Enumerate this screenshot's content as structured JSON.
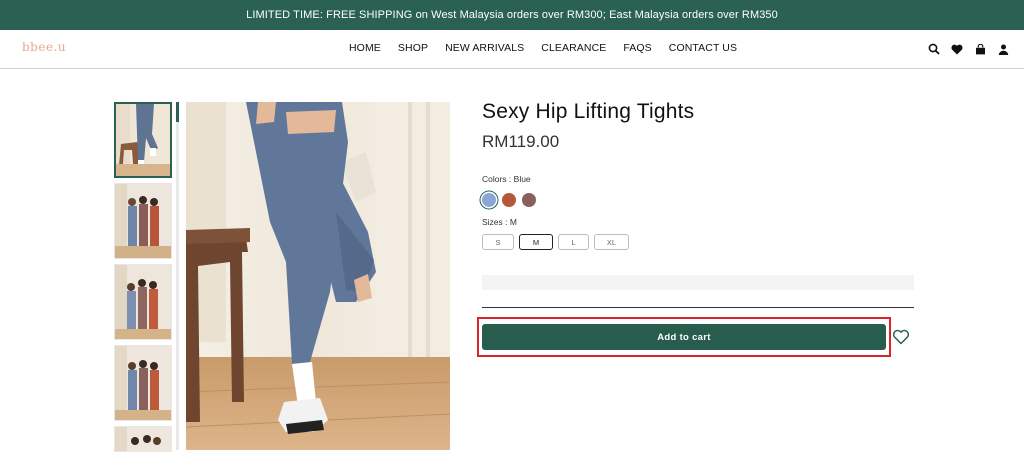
{
  "announcement": "LIMITED TIME: FREE SHIPPING on West Malaysia orders over RM300; East Malaysia orders over RM350",
  "brand": "bbee.u",
  "nav": [
    "HOME",
    "SHOP",
    "NEW ARRIVALS",
    "CLEARANCE",
    "FAQS",
    "CONTACT US"
  ],
  "header_icons": [
    "search-icon",
    "heart-icon",
    "bag-icon",
    "account-icon"
  ],
  "product": {
    "title": "Sexy Hip Lifting Tights",
    "price": "RM119.00",
    "colors_label": "Colors : Blue",
    "colors": [
      {
        "name": "Blue",
        "hex": "#8aa6d6",
        "selected": true
      },
      {
        "name": "Rust",
        "hex": "#b5583a",
        "selected": false
      },
      {
        "name": "Mauve",
        "hex": "#8a5f5c",
        "selected": false
      }
    ],
    "sizes_label": "Sizes : M",
    "sizes": [
      {
        "label": "S",
        "selected": false
      },
      {
        "label": "M",
        "selected": true
      },
      {
        "label": "L",
        "selected": false
      },
      {
        "label": "XL",
        "selected": false
      }
    ],
    "add_to_cart": "Add to cart"
  },
  "colors": {
    "brand_green": "#2a6152",
    "highlight_red": "#d8262c"
  }
}
